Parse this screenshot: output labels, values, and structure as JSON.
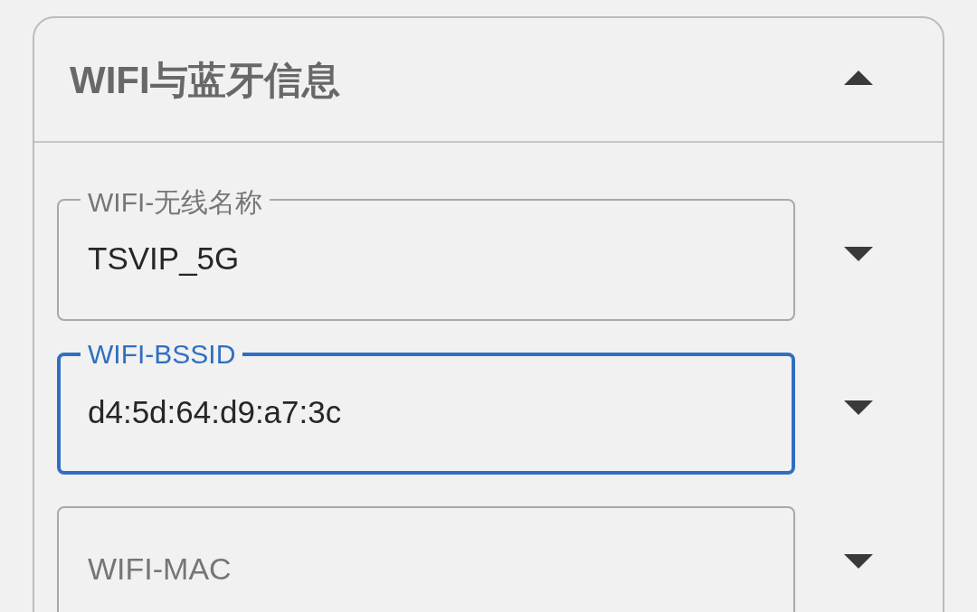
{
  "panel": {
    "title": "WIFI与蓝牙信息",
    "expanded": true
  },
  "fields": [
    {
      "label": "WIFI-无线名称",
      "value": "TSVIP_5G",
      "focused": false
    },
    {
      "label": "WIFI-BSSID",
      "value": "d4:5d:64:d9:a7:3c",
      "focused": true
    },
    {
      "label": "WIFI-MAC",
      "focused": false
    }
  ]
}
